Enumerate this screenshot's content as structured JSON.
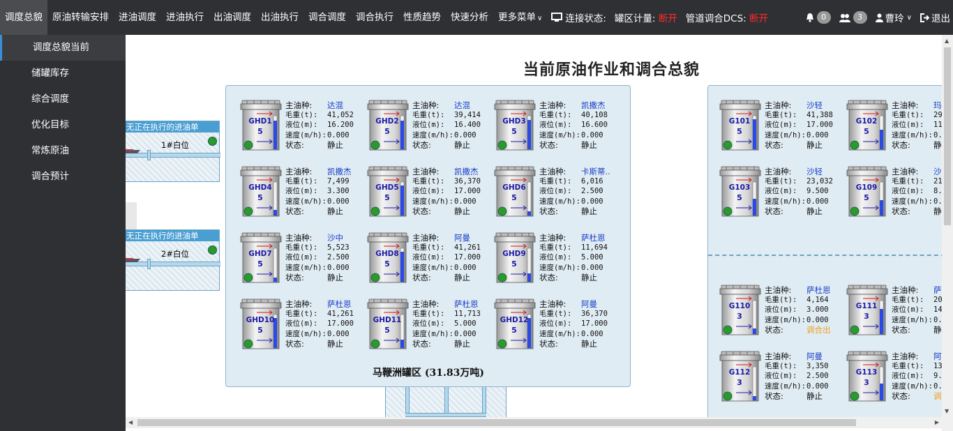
{
  "nav": {
    "items": [
      {
        "label": "调度总貌",
        "active": true
      },
      {
        "label": "原油转输安排"
      },
      {
        "label": "进油调度"
      },
      {
        "label": "进油执行"
      },
      {
        "label": "出油调度"
      },
      {
        "label": "出油执行"
      },
      {
        "label": "调合调度"
      },
      {
        "label": "调合执行"
      },
      {
        "label": "性质趋势"
      },
      {
        "label": "快速分析"
      }
    ],
    "more_label": "更多菜单",
    "connection_label": "连接状态:",
    "tank_meter_label": "罐区计量:",
    "tank_meter_status": "断开",
    "dcs_label": "管道调合DCS:",
    "dcs_status": "断开",
    "notifications_count": "0",
    "users_count": "3",
    "username": "曹玲",
    "logout_label": "退出"
  },
  "sidebar": {
    "items": [
      {
        "label": "调度总貌当前",
        "active": true
      },
      {
        "label": "储罐库存"
      },
      {
        "label": "综合调度"
      },
      {
        "label": "优化目标"
      },
      {
        "label": "常炼原油"
      },
      {
        "label": "调合预计"
      }
    ]
  },
  "page_title": "当前原油作业和调合总貌",
  "docks": [
    {
      "header": "无正在执行的进油单",
      "berth": "1#白位"
    },
    {
      "header": "无正在执行的进油单",
      "berth": "2#白位"
    }
  ],
  "field_labels": {
    "oil": "主油种:",
    "weight": "毛重(t):",
    "level": "液位(m):",
    "speed": "速度(m/h):",
    "status": "状态:"
  },
  "mabianzhou": {
    "label": "马鞭洲罐区 (31.83万吨)",
    "tanks": [
      {
        "id": "GHD1",
        "num": "5",
        "oil": "达混",
        "weight": "41,052",
        "level": "16.200",
        "speed": "0.000",
        "status": "静止",
        "fill": 0.85
      },
      {
        "id": "GHD2",
        "num": "5",
        "oil": "达混",
        "weight": "39,414",
        "level": "16.400",
        "speed": "0.000",
        "status": "静止",
        "fill": 0.86
      },
      {
        "id": "GHD3",
        "num": "5",
        "oil": "凯撒杰",
        "weight": "40,108",
        "level": "16.600",
        "speed": "0.000",
        "status": "静止",
        "fill": 0.87
      },
      {
        "id": "GHD4",
        "num": "5",
        "oil": "凯撒杰",
        "weight": "7,499",
        "level": "3.300",
        "speed": "0.000",
        "status": "静止",
        "fill": 0.17
      },
      {
        "id": "GHD5",
        "num": "5",
        "oil": "凯撒杰",
        "weight": "36,370",
        "level": "17.000",
        "speed": "0.000",
        "status": "静止",
        "fill": 0.89
      },
      {
        "id": "GHD6",
        "num": "5",
        "oil": "卡斯蒂..",
        "weight": "6,016",
        "level": "2.500",
        "speed": "0.000",
        "status": "静止",
        "fill": 0.13
      },
      {
        "id": "GHD7",
        "num": "5",
        "oil": "沙中",
        "weight": "5,523",
        "level": "2.500",
        "speed": "0.000",
        "status": "静止",
        "fill": 0.13
      },
      {
        "id": "GHD8",
        "num": "5",
        "oil": "阿曼",
        "weight": "41,261",
        "level": "17.000",
        "speed": "0.000",
        "status": "静止",
        "fill": 0.89
      },
      {
        "id": "GHD9",
        "num": "5",
        "oil": "萨杜恩",
        "weight": "11,694",
        "level": "5.000",
        "speed": "0.000",
        "status": "静止",
        "fill": 0.26
      },
      {
        "id": "GHD10",
        "num": "5",
        "oil": "萨杜恩",
        "weight": "41,261",
        "level": "17.000",
        "speed": "0.000",
        "status": "静止",
        "fill": 0.89
      },
      {
        "id": "GHD11",
        "num": "5",
        "oil": "萨杜恩",
        "weight": "11,713",
        "level": "5.000",
        "speed": "0.000",
        "status": "静止",
        "fill": 0.26
      },
      {
        "id": "GHD12",
        "num": "5",
        "oil": "阿曼",
        "weight": "36,370",
        "level": "17.000",
        "speed": "0.000",
        "status": "静止",
        "fill": 0.89
      }
    ]
  },
  "right_area": {
    "tanks": [
      {
        "id": "G101",
        "num": "5",
        "oil": "沙轻",
        "weight": "41,388",
        "level": "17.000",
        "speed": "0.000",
        "status": "静止",
        "fill": 0.89
      },
      {
        "id": "G102",
        "num": "5",
        "oil": "玛",
        "weight": "29",
        "level": "11",
        "speed": "0.",
        "status": "静",
        "fill": 0.58
      },
      {
        "id": "G103",
        "num": "5",
        "oil": "沙轻",
        "weight": "23,032",
        "level": "9.500",
        "speed": "0.000",
        "status": "静止",
        "fill": 0.5
      },
      {
        "id": "G109",
        "num": "5",
        "oil": "沙",
        "weight": "21",
        "level": "8.",
        "speed": "0.",
        "status": "静",
        "fill": 0.45
      },
      {
        "id": "G110",
        "num": "3",
        "oil": "萨杜恩",
        "weight": "4,164",
        "level": "3.000",
        "speed": "0.000",
        "status": "调合出",
        "status_color": "orange",
        "fill": 0.16
      },
      {
        "id": "G111",
        "num": "3",
        "oil": "萨",
        "weight": "20",
        "level": "14",
        "speed": "0.",
        "status": "静",
        "fill": 0.74
      },
      {
        "id": "G112",
        "num": "3",
        "oil": "阿曼",
        "weight": "3,350",
        "level": "2.500",
        "speed": "0.000",
        "status": "静止",
        "fill": 0.13
      },
      {
        "id": "G113",
        "num": "3",
        "oil": "阿",
        "weight": "13",
        "level": "9.",
        "speed": "0.",
        "status": "调",
        "status_color": "orange",
        "fill": 0.5
      }
    ]
  },
  "colors": {
    "nav_bg": "#2f3033",
    "panel_bg": "#e0ecf3",
    "panel_border": "#8cb4cc",
    "level_bar": "#2a4ae8",
    "status_red": "#ff2a2a",
    "status_orange": "#f0a020",
    "oil_name": "#1a3fc8"
  }
}
